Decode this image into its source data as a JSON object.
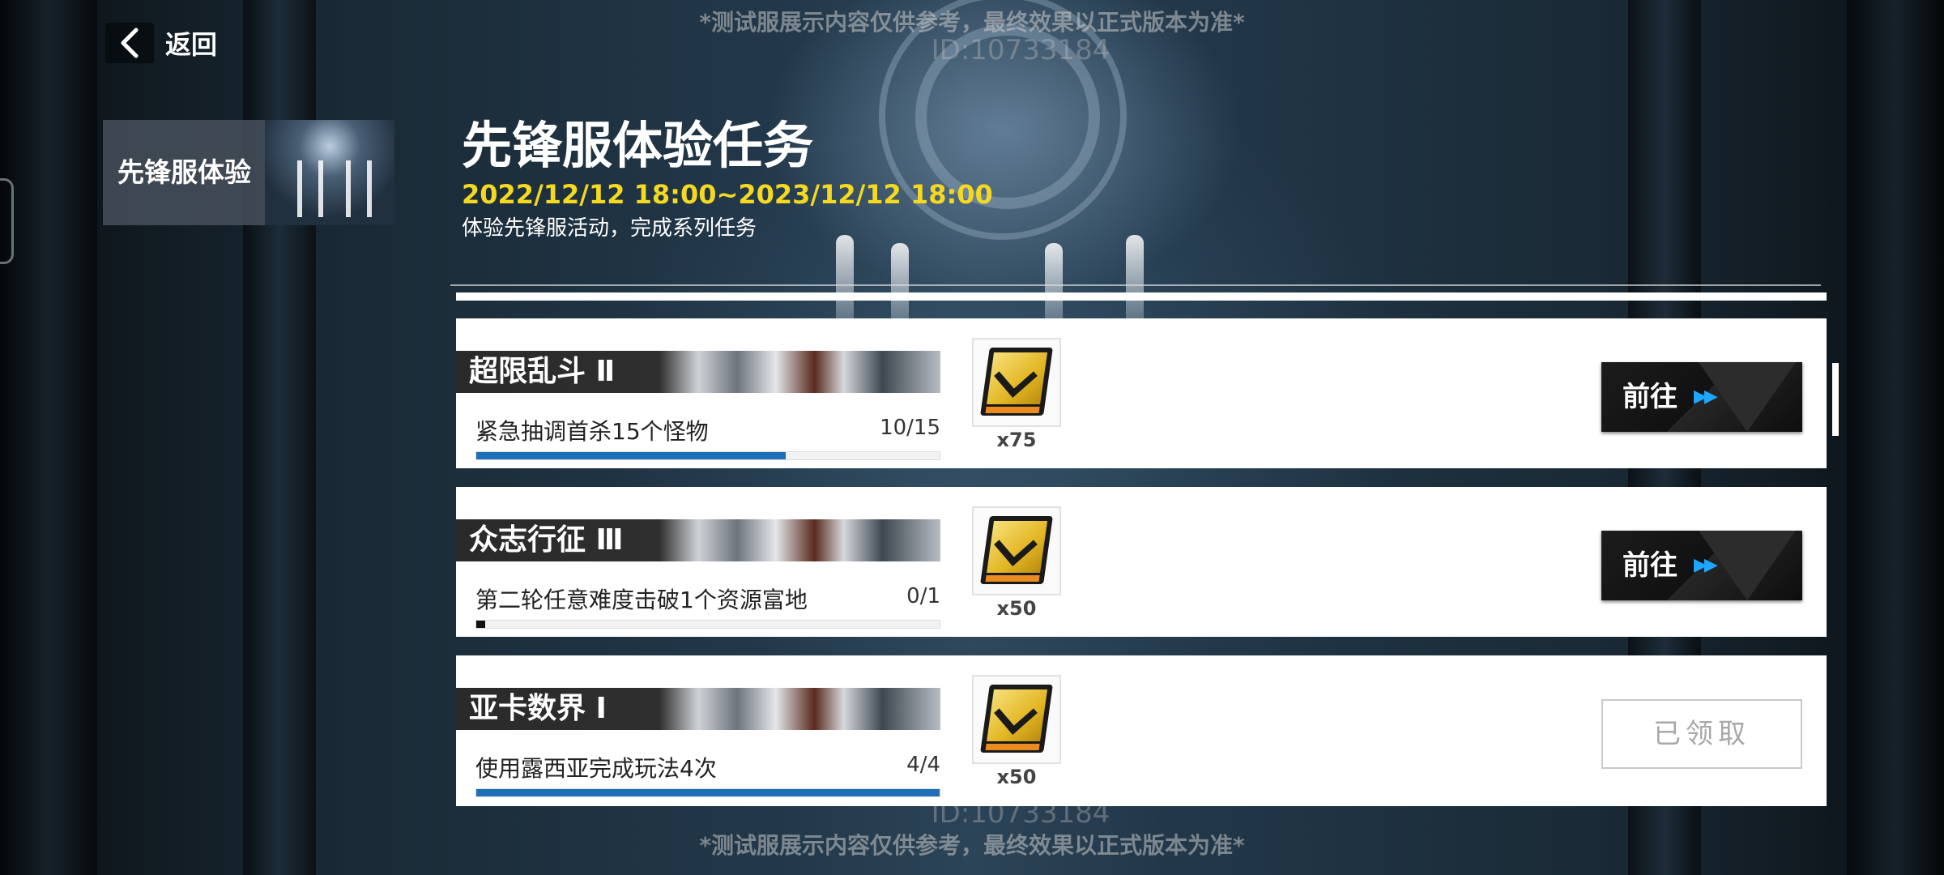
{
  "watermark": {
    "notice": "*测试服展示内容仅供参考，最终效果以正式版本为准*",
    "id": "ID:10733184"
  },
  "nav": {
    "back_label": "返回"
  },
  "sidebar": {
    "tab_label": "先锋服体验"
  },
  "event": {
    "title": "先锋服体验任务",
    "dates": "2022/12/12 18:00~2023/12/12 18:00",
    "description": "体验先锋服活动，完成系列任务"
  },
  "tasks": [
    {
      "title": "超限乱斗 Ⅱ",
      "requirement": "紧急抽调首杀15个怪物",
      "progress_text": "10/15",
      "progress": 0.667,
      "reward_count": "x75",
      "action": "前往",
      "claimed": false
    },
    {
      "title": "众志行征 Ⅲ",
      "requirement": "第二轮任意难度击破1个资源富地",
      "progress_text": "0/1",
      "progress": 0.02,
      "reward_count": "x50",
      "action": "前往",
      "claimed": false
    },
    {
      "title": "亚卡数界 Ⅰ",
      "requirement": "使用露西亚完成玩法4次",
      "progress_text": "4/4",
      "progress": 1.0,
      "reward_count": "x50",
      "action": "已领取",
      "claimed": true
    }
  ],
  "colors": {
    "date_yellow": "#f5d820",
    "progress_blue": "#1d6fb8",
    "arrow_blue": "#1ea7ff"
  }
}
